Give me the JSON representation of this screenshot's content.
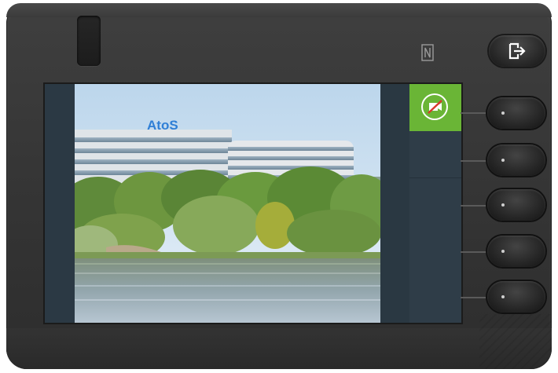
{
  "wallpaper": {
    "brand_text": "AtoS",
    "brand_color": "#2f7fd6"
  },
  "softkeys": {
    "active_icon": "no-video-icon",
    "active_color": "#6ab536"
  },
  "hardware": {
    "nfc_icon": "nfc-icon",
    "exit_icon": "exit-arrow-icon",
    "line_keys": [
      "line-key-1",
      "line-key-2",
      "line-key-3",
      "line-key-4",
      "line-key-5"
    ]
  }
}
